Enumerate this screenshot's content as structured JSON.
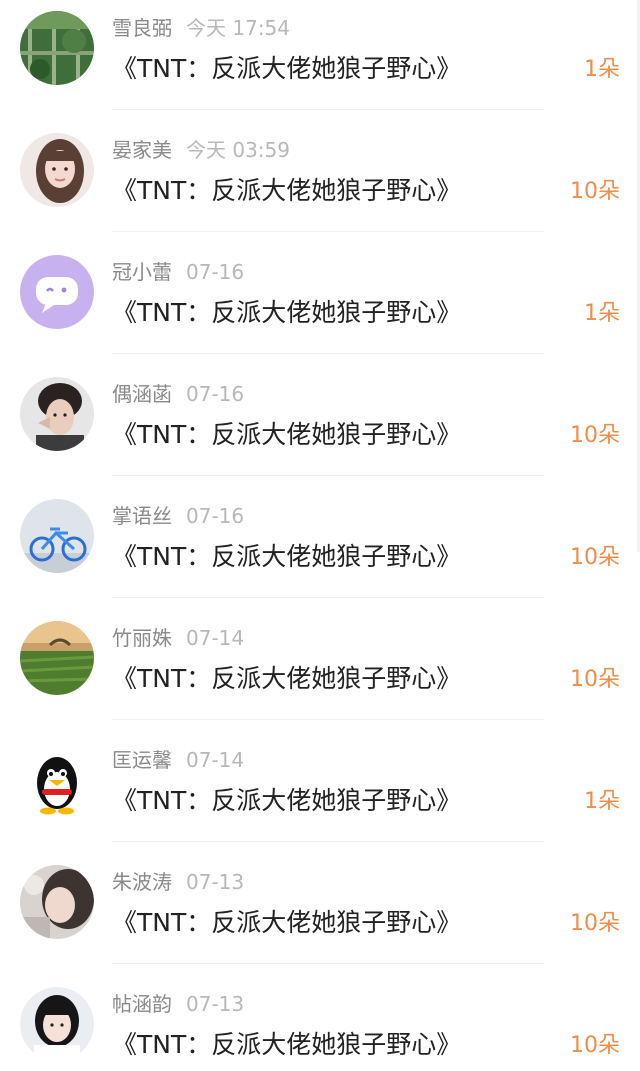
{
  "accent_color": "#ef8c4a",
  "items": [
    {
      "name": "雪良弼",
      "time": "今天 17:54",
      "title": "《TNT：反派大佬她狼子野心》",
      "count": "1朵",
      "avatar": "avatar-green-field"
    },
    {
      "name": "晏家美",
      "time": "今天 03:59",
      "title": "《TNT：反派大佬她狼子野心》",
      "count": "10朵",
      "avatar": "avatar-woman"
    },
    {
      "name": "冠小蕾",
      "time": "07-16",
      "title": "《TNT：反派大佬她狼子野心》",
      "count": "1朵",
      "avatar": "avatar-purple-chat-bubble"
    },
    {
      "name": "偶涵菡",
      "time": "07-16",
      "title": "《TNT：反派大佬她狼子野心》",
      "count": "10朵",
      "avatar": "avatar-man"
    },
    {
      "name": "掌语丝",
      "time": "07-16",
      "title": "《TNT：反派大佬她狼子野心》",
      "count": "10朵",
      "avatar": "avatar-bicycle"
    },
    {
      "name": "竹丽姝",
      "time": "07-14",
      "title": "《TNT：反派大佬她狼子野心》",
      "count": "10朵",
      "avatar": "avatar-field-sunset"
    },
    {
      "name": "匡运馨",
      "time": "07-14",
      "title": "《TNT：反派大佬她狼子野心》",
      "count": "1朵",
      "avatar": "avatar-penguin"
    },
    {
      "name": "朱波涛",
      "time": "07-13",
      "title": "《TNT：反派大佬她狼子野心》",
      "count": "10朵",
      "avatar": "avatar-girl-blur"
    },
    {
      "name": "帖涵韵",
      "time": "07-13",
      "title": "《TNT：反派大佬她狼子野心》",
      "count": "10朵",
      "avatar": "avatar-girl"
    }
  ]
}
